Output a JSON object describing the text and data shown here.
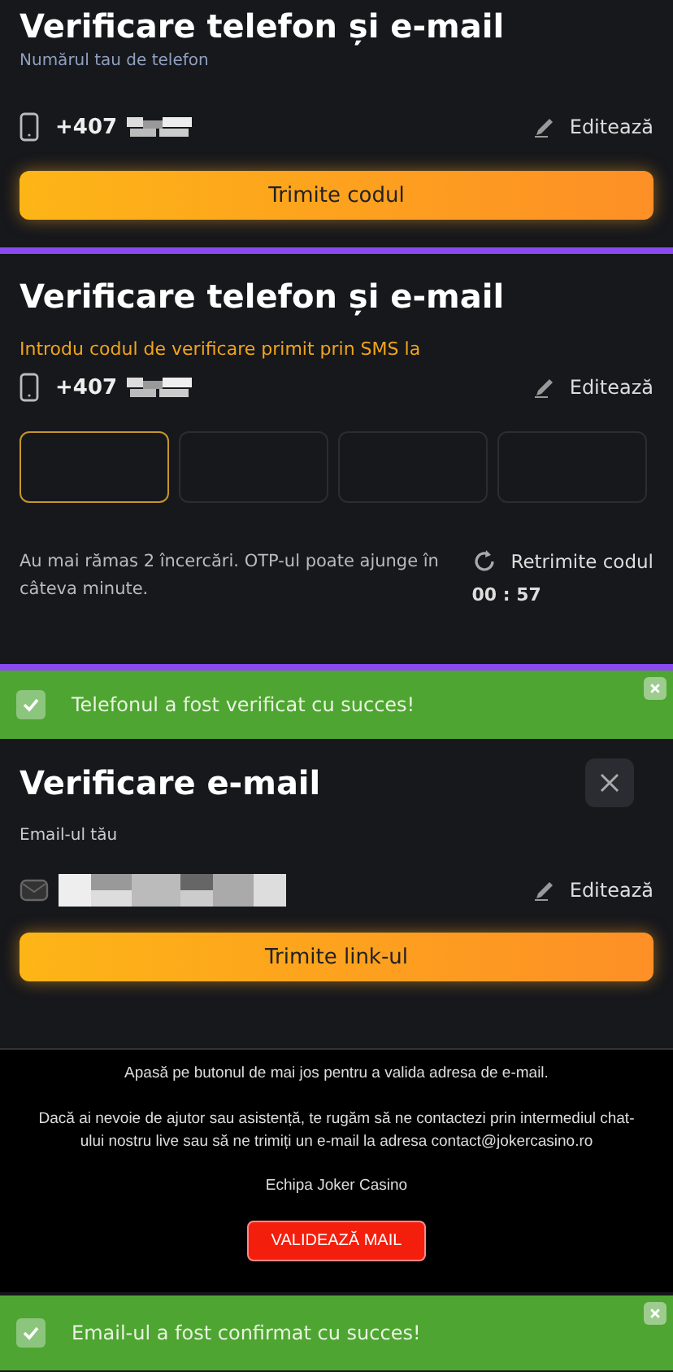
{
  "phone_step": {
    "title": "Verificare telefon și e-mail",
    "label": "Numărul tau de telefon",
    "phone": "+407",
    "edit": "Editează",
    "button": "Trimite codul"
  },
  "otp_step": {
    "title": "Verificare telefon și e-mail",
    "prompt": "Introdu codul de verificare primit prin SMS la",
    "phone": "+407",
    "edit": "Editează",
    "code_boxes": [
      {
        "selected": true
      },
      {
        "selected": false
      },
      {
        "selected": false
      },
      {
        "selected": false
      }
    ],
    "hint": "Au mai rămas 2 încercări. OTP-ul poate ajunge în câteva minute.",
    "resend": "Retrimite codul",
    "timer": "00 : 57"
  },
  "phone_toast": {
    "text": "Telefonul a fost verificat cu succes!"
  },
  "email_step": {
    "title": "Verificare e-mail",
    "label": "Email-ul tău",
    "edit": "Editează",
    "button": "Trimite link-ul"
  },
  "email_message": {
    "paragraphs": [
      "Apasă pe butonul de mai jos pentru a valida adresa de e-mail.",
      "Dacă ai nevoie de ajutor sau asistență, te rugăm să ne contactezi prin intermediul chat-ului nostru live sau să ne trimiți un e-mail la adresa contact@jokercasino.ro",
      "Echipa Joker Casino"
    ],
    "button": "VALIDEAZĂ MAIL"
  },
  "email_toast": {
    "text": "Email-ul a fost confirmat cu succes!"
  }
}
